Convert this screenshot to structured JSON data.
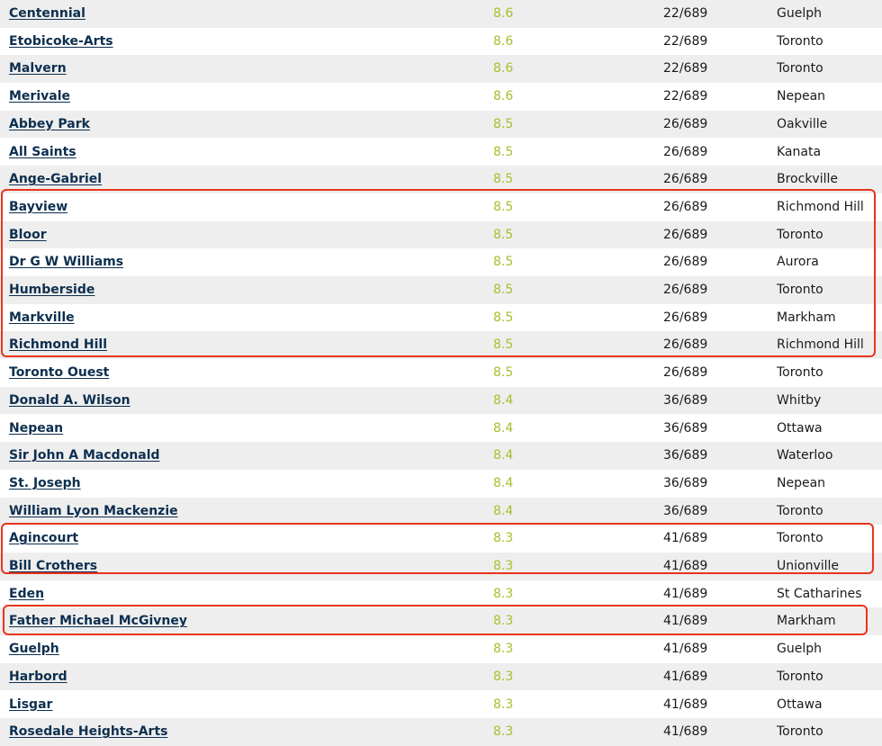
{
  "schools": [
    {
      "name": "Centennial",
      "score": "8.6",
      "rank": "22/689",
      "city": "Guelph"
    },
    {
      "name": "Etobicoke-Arts",
      "score": "8.6",
      "rank": "22/689",
      "city": "Toronto"
    },
    {
      "name": "Malvern",
      "score": "8.6",
      "rank": "22/689",
      "city": "Toronto"
    },
    {
      "name": "Merivale",
      "score": "8.6",
      "rank": "22/689",
      "city": "Nepean"
    },
    {
      "name": "Abbey Park",
      "score": "8.5",
      "rank": "26/689",
      "city": "Oakville"
    },
    {
      "name": "All Saints",
      "score": "8.5",
      "rank": "26/689",
      "city": "Kanata"
    },
    {
      "name": "Ange-Gabriel",
      "score": "8.5",
      "rank": "26/689",
      "city": "Brockville"
    },
    {
      "name": "Bayview",
      "score": "8.5",
      "rank": "26/689",
      "city": "Richmond Hill"
    },
    {
      "name": "Bloor",
      "score": "8.5",
      "rank": "26/689",
      "city": "Toronto"
    },
    {
      "name": "Dr G W Williams",
      "score": "8.5",
      "rank": "26/689",
      "city": "Aurora"
    },
    {
      "name": "Humberside",
      "score": "8.5",
      "rank": "26/689",
      "city": "Toronto"
    },
    {
      "name": "Markville",
      "score": "8.5",
      "rank": "26/689",
      "city": "Markham"
    },
    {
      "name": "Richmond Hill",
      "score": "8.5",
      "rank": "26/689",
      "city": "Richmond Hill"
    },
    {
      "name": "Toronto Ouest",
      "score": "8.5",
      "rank": "26/689",
      "city": "Toronto"
    },
    {
      "name": "Donald A. Wilson",
      "score": "8.4",
      "rank": "36/689",
      "city": "Whitby"
    },
    {
      "name": "Nepean",
      "score": "8.4",
      "rank": "36/689",
      "city": "Ottawa"
    },
    {
      "name": "Sir John A Macdonald",
      "score": "8.4",
      "rank": "36/689",
      "city": "Waterloo"
    },
    {
      "name": "St. Joseph",
      "score": "8.4",
      "rank": "36/689",
      "city": "Nepean"
    },
    {
      "name": "William Lyon Mackenzie",
      "score": "8.4",
      "rank": "36/689",
      "city": "Toronto"
    },
    {
      "name": "Agincourt",
      "score": "8.3",
      "rank": "41/689",
      "city": "Toronto"
    },
    {
      "name": "Bill Crothers",
      "score": "8.3",
      "rank": "41/689",
      "city": "Unionville"
    },
    {
      "name": "Eden",
      "score": "8.3",
      "rank": "41/689",
      "city": "St Catharines"
    },
    {
      "name": "Father Michael McGivney",
      "score": "8.3",
      "rank": "41/689",
      "city": "Markham"
    },
    {
      "name": "Guelph",
      "score": "8.3",
      "rank": "41/689",
      "city": "Guelph"
    },
    {
      "name": "Harbord",
      "score": "8.3",
      "rank": "41/689",
      "city": "Toronto"
    },
    {
      "name": "Lisgar",
      "score": "8.3",
      "rank": "41/689",
      "city": "Ottawa"
    },
    {
      "name": "Rosedale Heights-Arts",
      "score": "8.3",
      "rank": "41/689",
      "city": "Toronto"
    }
  ],
  "colors": {
    "link": "#0d2f4f",
    "score": "#a7bf2b",
    "alt_row": "#eeeeee",
    "highlight": "#e8341c"
  }
}
